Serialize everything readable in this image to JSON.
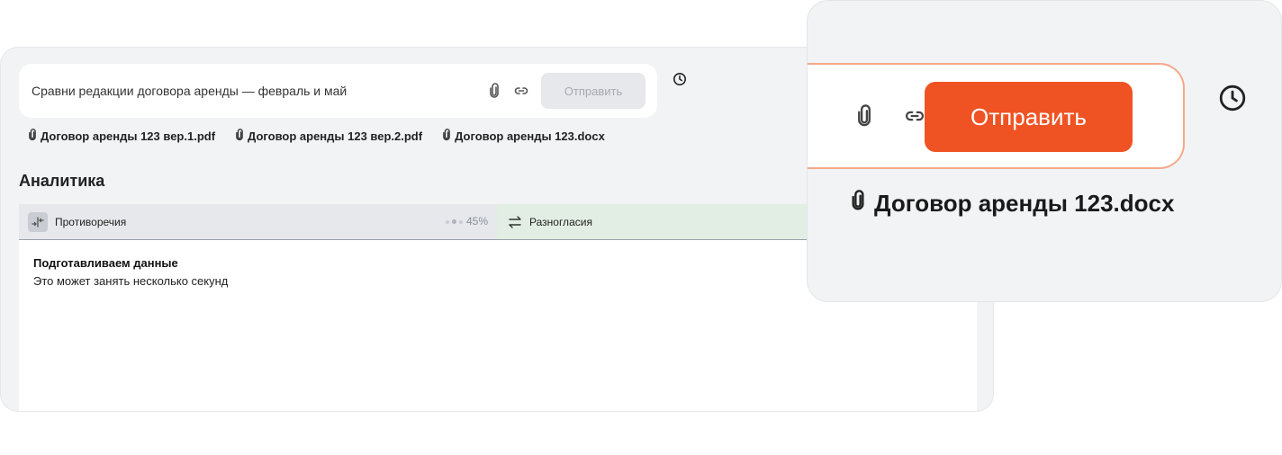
{
  "input": {
    "query": "Сравни редакции договора аренды — февраль и май",
    "send_label": "Отправить"
  },
  "attachments": [
    {
      "name": "Договор аренды 123 вер.1.pdf"
    },
    {
      "name": "Договор аренды 123 вер.2.pdf"
    },
    {
      "name": "Договор аренды 123.docx"
    }
  ],
  "analytics": {
    "title": "Аналитика",
    "tabs": [
      {
        "label": "Противоречия",
        "progress": "45%"
      },
      {
        "label": "Разногласия"
      }
    ],
    "loading_title": "Подготавливаем данные",
    "loading_subtitle": "Это может занять несколько секунд"
  },
  "zoom": {
    "send_label": "Отправить",
    "file_name": "Договор аренды 123.docx"
  },
  "colors": {
    "accent": "#f05323",
    "panel_bg": "#f2f3f5",
    "tab_active_bg": "#e2eee4"
  },
  "icons": [
    "paperclip-icon",
    "link-icon",
    "clock-icon",
    "contradiction-icon",
    "swap-icon"
  ]
}
